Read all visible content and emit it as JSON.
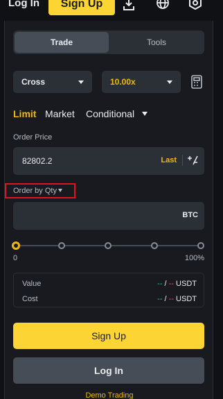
{
  "header": {
    "login_label": "Log In",
    "signup_label": "Sign Up",
    "icons": [
      "download-icon",
      "globe-icon",
      "settings-icon"
    ]
  },
  "panel": {
    "tabs": [
      {
        "label": "Trade",
        "active": true
      },
      {
        "label": "Tools",
        "active": false
      }
    ],
    "margin_mode": "Cross",
    "leverage": "10.00x",
    "order_types": [
      {
        "label": "Limit",
        "active": true
      },
      {
        "label": "Market",
        "active": false
      },
      {
        "label": "Conditional",
        "active": false
      }
    ],
    "order_price": {
      "label": "Order Price",
      "value": "82802.2",
      "last_label": "Last"
    },
    "qty": {
      "label": "Order by Qty",
      "unit": "BTC"
    },
    "slider": {
      "min_label": "0",
      "max_label": "100%",
      "level": 0
    },
    "info": [
      {
        "key": "Value",
        "green": "--",
        "slash": " / ",
        "red": "--",
        "unit": " USDT"
      },
      {
        "key": "Cost",
        "green": "--",
        "slash": " / ",
        "red": "--",
        "unit": " USDT"
      }
    ],
    "signup_button": "Sign Up",
    "login_button": "Log In",
    "demo_link": "Demo Trading"
  },
  "colors": {
    "accent": "#fcd535",
    "highlight": "#f0b90b",
    "positive": "#0ecb81",
    "negative": "#f6465d",
    "annotation": "#e0141e"
  }
}
